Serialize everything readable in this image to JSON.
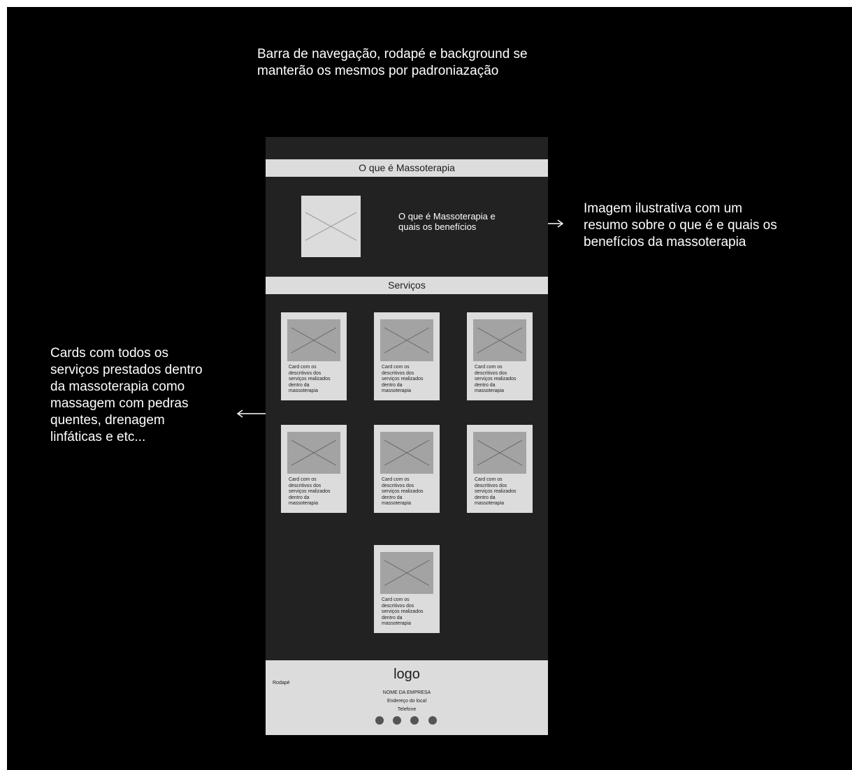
{
  "annotations": {
    "top": "Barra de navegação, rodapé e background se\nmanterão os mesmos por padroniazação",
    "right": "Imagem ilustrativa com um\nresumo sobre o que é e quais os\nbenefícios da massoterapia",
    "left": "Cards com todos os\nserviços prestados dentro\nda massoterapia como\nmassagem com pedras\nquentes, drenagem\nlinfáticas e etc..."
  },
  "sections": {
    "about_title": "O que é Massoterapia",
    "about_text": "O que é Massoterapia e\nquais os benefícios",
    "services_title": "Serviços"
  },
  "cards": [
    {
      "text": "Card com os\ndescritivos dos\nserviços realizados\ndentro da\nmassoterapia"
    },
    {
      "text": "Card com os\ndescritivos dos\nserviços realizados\ndentro da\nmassoterapia"
    },
    {
      "text": "Card com os\ndescritivos dos\nserviços realizados\ndentro da\nmassoterapia"
    },
    {
      "text": "Card com os\ndescritivos dos\nserviços realizados\ndentro da\nmassoterapia"
    },
    {
      "text": "Card com os\ndescritivos dos\nserviços realizados\ndentro da\nmassoterapia"
    },
    {
      "text": "Card com os\ndescritivos dos\nserviços realizados\ndentro da\nmassoterapia"
    },
    {
      "text": "Card com os\ndescritivos dos\nserviços realizados\ndentro da\nmassoterapia"
    }
  ],
  "footer": {
    "label": "Rodapé",
    "logo": "logo",
    "company": "NOME DA EMPRESA",
    "address": "Endereço do local",
    "phone": "Telefone",
    "social_icons": [
      "social-icon-1",
      "social-icon-2",
      "social-icon-3",
      "social-icon-4"
    ]
  },
  "colors": {
    "background": "#000000",
    "frame": "#222222",
    "bar": "#dcdcdc",
    "placeholder": "#a3a3a3"
  }
}
